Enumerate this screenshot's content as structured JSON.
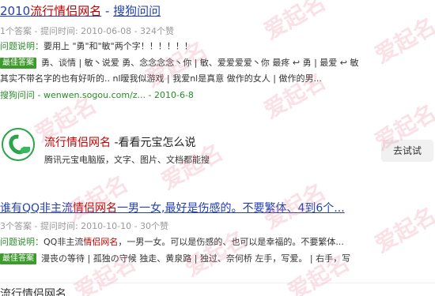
{
  "result1": {
    "title_year": "2010",
    "title_keyword": "流行情侣网名",
    "title_sep": " - ",
    "title_site": "搜狗问问",
    "meta": "1个答案 - 提问时间: 2010-06-08 - 324个赞",
    "question_label": "问题说明：",
    "question_text": "要用上 \"勇\"和\"敏\"两个字！！！！！！",
    "best_badge": "最佳答案",
    "best_line1": "勇、谈情 | 敏丶说爱 勇、念念念念丶你 | 敏、爱爱爱爱丶你 最疼 ↩︎ 勇 | 最爱 ↩︎ 敏",
    "best_line2": "其实不带名字的也有好听的.. nl暧我似游戏 | 我爱nl是真意 做作的女人 | 做作的男...",
    "source": "搜狗问问 - wenwen.sogou.com/z... - 2010-6-8"
  },
  "card": {
    "title_keyword": "流行情侣网名",
    "title_rest": " -看看元宝怎么说",
    "subtitle": "腾讯元宝电脑版，文字、图片、文档都能搜",
    "button_label": "去试试"
  },
  "result2": {
    "title_a": "谁有QQ非主流",
    "title_keyword": "情侣网名",
    "title_b": "一男一女,最好是伤感的。不要繁体、4到6个...",
    "meta": "3个答案 - 提问时间: 2010-10-10 - 30个赞",
    "question_label": "问题说明：",
    "question_a": "QQ非主流",
    "question_keyword": "情侣网名",
    "question_b": "，一男一女。可以是伤感的、也可以是幸福的。不要繁体...",
    "best_badge": "最佳答案",
    "best_text": "漫丧の等待 | 孤独の守候 独走、黄泉路 | 独过、奈何桥 左手，写爱。 | 右手，写"
  },
  "result3": {
    "title": "流行情侣网名"
  },
  "watermark": {
    "text": "爱起名",
    "color": "#e6788c"
  },
  "colors": {
    "link": "#2440b3",
    "highlight": "#c00000",
    "green": "#2a8a2a",
    "badge": "#3d9a2c"
  }
}
